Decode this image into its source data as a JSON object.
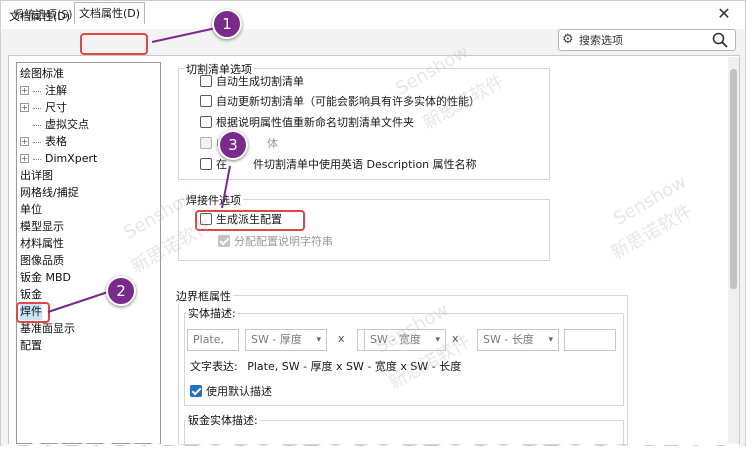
{
  "window": {
    "title": "文档属性(D) - 焊件",
    "close_glyph": "✕"
  },
  "tabs": [
    {
      "label": "系统选项(S)"
    },
    {
      "label": "文档属性(D)"
    }
  ],
  "search": {
    "placeholder": "搜索选项",
    "gear_icon": "gear-icon",
    "search_icon": "search-icon"
  },
  "tree": {
    "items": [
      {
        "label": "绘图标准",
        "expandable": false,
        "indent": 0
      },
      {
        "label": "注解",
        "expandable": true,
        "indent": 1
      },
      {
        "label": "尺寸",
        "expandable": true,
        "indent": 1
      },
      {
        "label": "虚拟交点",
        "expandable": false,
        "indent": 1
      },
      {
        "label": "表格",
        "expandable": true,
        "indent": 1
      },
      {
        "label": "DimXpert",
        "expandable": true,
        "indent": 1
      },
      {
        "label": "出详图",
        "expandable": false,
        "indent": 0
      },
      {
        "label": "网格线/捕捉",
        "expandable": false,
        "indent": 0
      },
      {
        "label": "单位",
        "expandable": false,
        "indent": 0
      },
      {
        "label": "模型显示",
        "expandable": false,
        "indent": 0
      },
      {
        "label": "材料属性",
        "expandable": false,
        "indent": 0
      },
      {
        "label": "图像品质",
        "expandable": false,
        "indent": 0
      },
      {
        "label": "钣金 MBD",
        "expandable": false,
        "indent": 0
      },
      {
        "label": "钣金",
        "expandable": false,
        "indent": 0
      },
      {
        "label": "焊件",
        "expandable": false,
        "indent": 0,
        "selected": true
      },
      {
        "label": "基准面显示",
        "expandable": false,
        "indent": 0
      },
      {
        "label": "配置",
        "expandable": false,
        "indent": 0
      }
    ]
  },
  "cutlist": {
    "title": "切割清单选项",
    "options": [
      {
        "label": "自动生成切割清单",
        "checked": false,
        "disabled": false
      },
      {
        "label": "自动更新切割清单（可能会影响具有许多实体的性能）",
        "checked": false,
        "disabled": false
      },
      {
        "label": "根据说明属性值重新命名切割清单文件夹",
        "checked": false,
        "disabled": false
      },
      {
        "label": "收",
        "label2": "体",
        "checked": false,
        "disabled": true
      },
      {
        "label": "在",
        "label2": "件切割清单中使用英语 Description 属性名称",
        "checked": false,
        "disabled": false
      }
    ]
  },
  "weldment": {
    "title": "焊接件选项",
    "generate_derived": {
      "label": "生成派生配置",
      "checked": false
    },
    "assign_desc": {
      "label": "分配配置说明字符串",
      "checked": true,
      "disabled": true
    }
  },
  "bbox": {
    "title": "边界框属性",
    "solid_desc_title": "实体描述:",
    "prefix": "Plate,",
    "dropdowns": [
      "SW - 厚度",
      "SW - 宽度",
      "SW - 长度"
    ],
    "separator": "x",
    "expression_label": "文字表达:",
    "expression_value": "Plate, SW - 厚度 x SW - 宽度 x SW - 长度",
    "use_default": {
      "label": "使用默认描述",
      "checked": true
    },
    "sheet_metal_title": "钣金实体描述:"
  },
  "callouts": [
    "1",
    "2",
    "3"
  ],
  "watermark": {
    "line1": "Senshow",
    "line2": "新思诺软件"
  },
  "colors": {
    "highlight": "#e04848",
    "callout": "#7a2a8c",
    "selection": "#cce4f7",
    "accent": "#1f6fc4"
  }
}
